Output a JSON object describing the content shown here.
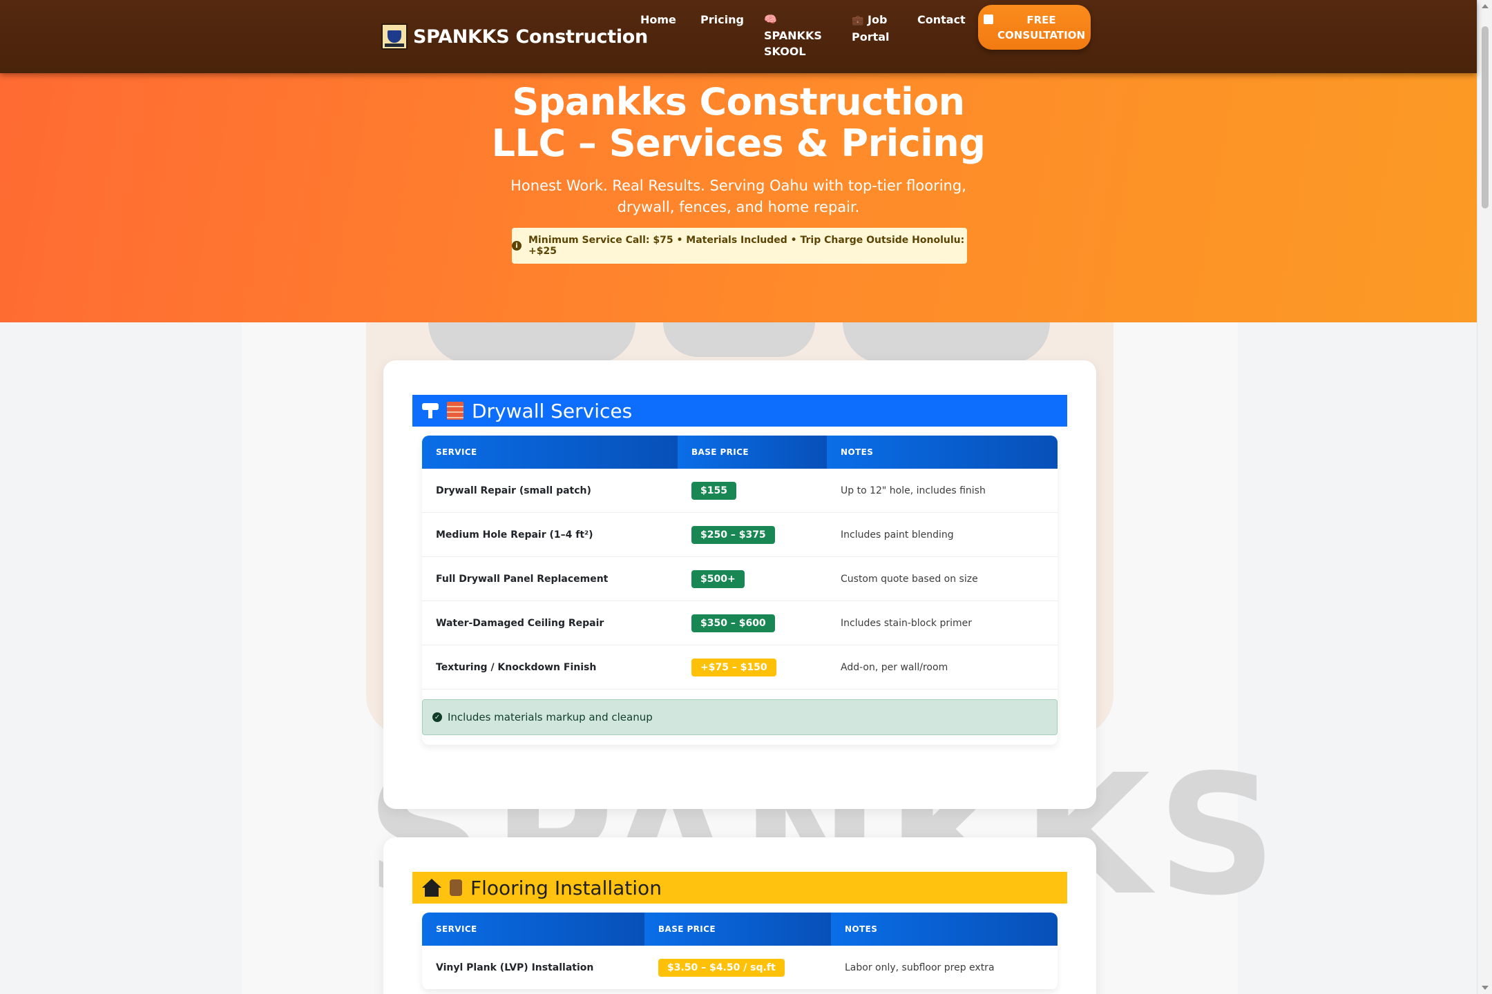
{
  "nav": {
    "brand": "SPANKKS Construction",
    "items": [
      {
        "label": "Home"
      },
      {
        "label": "Pricing"
      },
      {
        "icon": "🧠",
        "label": "SPANKKS SKOOL"
      },
      {
        "icon": "💼",
        "label": "Job Portal"
      },
      {
        "label": "Contact"
      }
    ],
    "cta": "FREE CONSULTATION"
  },
  "hero": {
    "title": "Spankks Construction LLC – Services & Pricing",
    "subtitle": "Honest Work. Real Results. Serving Oahu with top-tier flooring, drywall, fences, and home repair.",
    "notice": "Minimum Service Call: $75 • Materials Included • Trip Charge Outside Honolulu: +$25"
  },
  "watermark": "SPANKKS",
  "drywall": {
    "title": "Drywall Services",
    "header_color": "#0d6efd",
    "columns": [
      "Service",
      "Base Price",
      "Notes"
    ],
    "rows": [
      {
        "service": "Drywall Repair (small patch)",
        "price": "$155",
        "price_style": "green",
        "notes": "Up to 12\" hole, includes finish"
      },
      {
        "service": "Medium Hole Repair (1–4 ft²)",
        "price": "$250 – $375",
        "price_style": "green",
        "notes": "Includes paint blending"
      },
      {
        "service": "Full Drywall Panel Replacement",
        "price": "$500+",
        "price_style": "green",
        "notes": "Custom quote based on size"
      },
      {
        "service": "Water-Damaged Ceiling Repair",
        "price": "$350 – $600",
        "price_style": "green",
        "notes": "Includes stain-block primer"
      },
      {
        "service": "Texturing / Knockdown Finish",
        "price": "+$75 – $150",
        "price_style": "yellow",
        "notes": "Add-on, per wall/room"
      }
    ],
    "footer_note": "Includes materials markup and cleanup"
  },
  "flooring": {
    "title": "Flooring Installation",
    "header_color": "#ffc20e",
    "columns": [
      "Service",
      "Base Price",
      "Notes"
    ],
    "rows": [
      {
        "service": "Vinyl Plank (LVP) Installation",
        "price": "$3.50 – $4.50 / sq.ft",
        "price_style": "yellow",
        "notes": "Labor only, subfloor prep extra"
      }
    ]
  },
  "colors": {
    "nav_bg": "#4a230b",
    "hero_start": "#ff6a33",
    "hero_end": "#fb9a24",
    "price_green": "#198754",
    "price_yellow": "#ffc107"
  }
}
